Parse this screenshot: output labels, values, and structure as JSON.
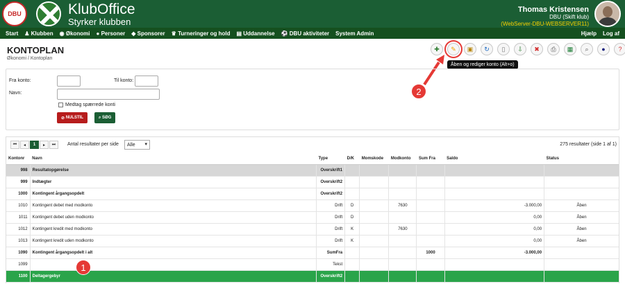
{
  "header": {
    "logo_text": "DBU",
    "brand_title": "KlubOffice",
    "brand_subtitle": "Styrker klubben",
    "user_name": "Thomas Kristensen",
    "user_club": "DBU (Skift klub)",
    "user_server": "(WebServer-DBU-WEBSERVER11)"
  },
  "nav": {
    "items": [
      "Start",
      "Klubben",
      "Økonomi",
      "Personer",
      "Sponsorer",
      "Turneringer og hold",
      "Uddannelse",
      "DBU aktiviteter",
      "System Admin"
    ],
    "right": [
      "Hjælp",
      "Log af"
    ]
  },
  "page": {
    "title": "KONTOPLAN",
    "breadcrumb": "Økonomi / Kontoplan"
  },
  "toolbar": {
    "tooltip": "Åben og rediger konto (Alt+o)",
    "badge_2": "2",
    "badge_1": "1"
  },
  "filter": {
    "fra_label": "Fra konto:",
    "til_label": "Til konto:",
    "navn_label": "Navn:",
    "checkbox_label": "Medtag spærrede konti",
    "reset_label": "NULSTIL",
    "search_label": "SØG"
  },
  "pager": {
    "first": "⏮",
    "prev": "◂",
    "current": "1",
    "next": "▸",
    "last": "⏭",
    "per_page_label": "Antal resultater per side",
    "per_page_value": "Alle",
    "count": "275 resultater (side 1 af 1)"
  },
  "table": {
    "headers": [
      "Kontonr",
      "Navn",
      "Type",
      "D/K",
      "Momskode",
      "Modkonto",
      "Sum Fra",
      "Saldo",
      "Status"
    ],
    "rows": [
      [
        "998",
        "Resultatopgørelse",
        "Overskrift1",
        "",
        "",
        "",
        "",
        "",
        ""
      ],
      [
        "999",
        "Indtægter",
        "Overskrift2",
        "",
        "",
        "",
        "",
        "",
        ""
      ],
      [
        "1000",
        "Kontingent årgangsopdelt",
        "Overskrift2",
        "",
        "",
        "",
        "",
        "",
        ""
      ],
      [
        "1010",
        "Kontingent debet med modkonto",
        "Drift",
        "D",
        "",
        "7630",
        "",
        "-3.000,00",
        "Åben"
      ],
      [
        "1011",
        "Kontingent debet uden modkonto",
        "Drift",
        "D",
        "",
        "",
        "",
        "0,00",
        "Åben"
      ],
      [
        "1012",
        "Kontingent kredit med modkonto",
        "Drift",
        "K",
        "",
        "7630",
        "",
        "0,00",
        "Åben"
      ],
      [
        "1013",
        "Kontingent kredit uden modkonto",
        "Drift",
        "K",
        "",
        "",
        "",
        "0,00",
        "Åben"
      ],
      [
        "1090",
        "Kontingent årgangsopdelt i alt",
        "SumFra",
        "",
        "",
        "",
        "1000",
        "-3.000,00",
        ""
      ],
      [
        "1099",
        "",
        "Tekst",
        "",
        "",
        "",
        "",
        "",
        ""
      ],
      [
        "1100",
        "Deltagergebyr",
        "Overskrift2",
        "",
        "",
        "",
        "",
        "",
        ""
      ]
    ]
  }
}
